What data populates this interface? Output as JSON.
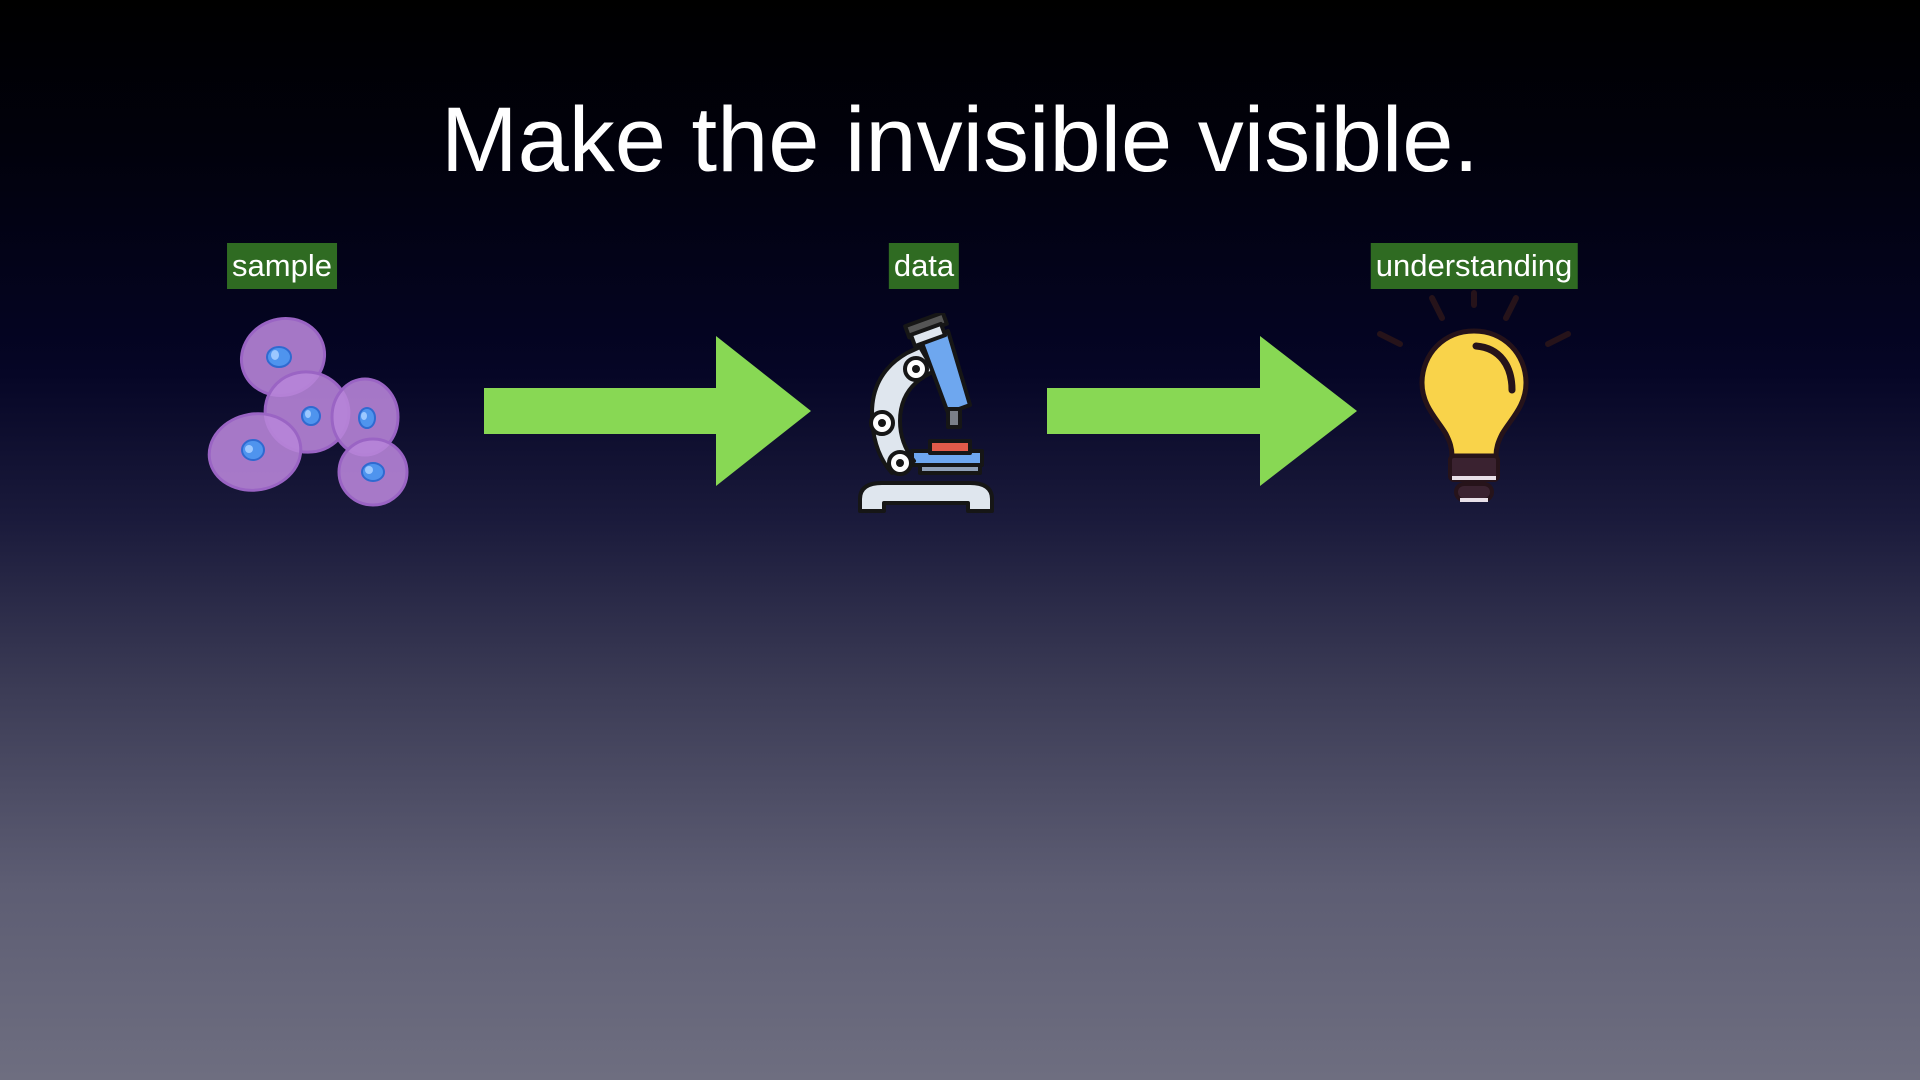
{
  "slide": {
    "title": "Make the invisible visible."
  },
  "flow": {
    "stages": [
      {
        "label": "sample",
        "icon": "cells-icon"
      },
      {
        "label": "data",
        "icon": "microscope-icon"
      },
      {
        "label": "understanding",
        "icon": "lightbulb-icon"
      }
    ],
    "colors": {
      "label_background": "#2f6b22",
      "arrow": "#88d854",
      "cells": "#b784d8",
      "nucleus": "#4f94ee",
      "bulb": "#f9d34a"
    }
  }
}
